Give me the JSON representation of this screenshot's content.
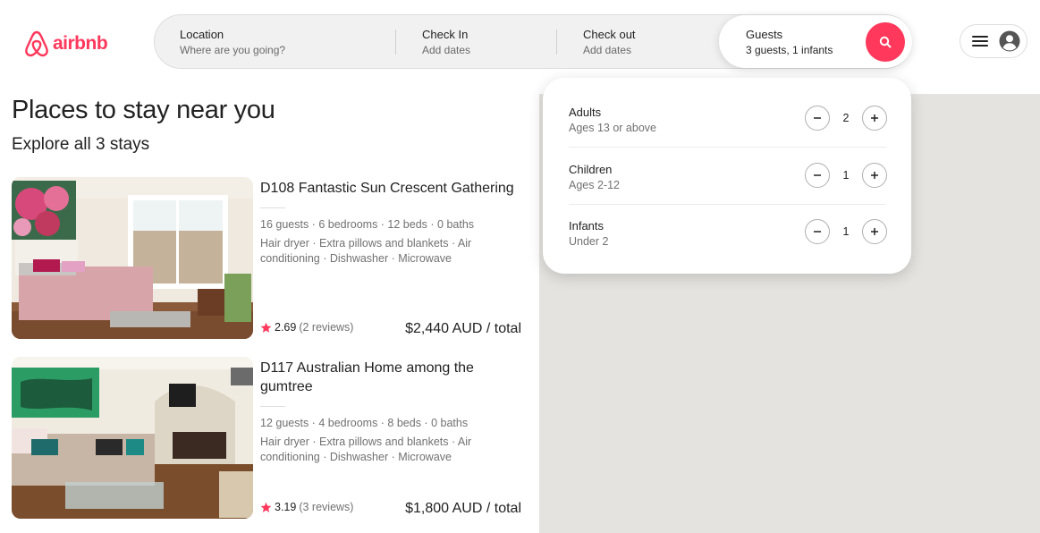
{
  "brand": {
    "name": "airbnb",
    "color": "#FF385C"
  },
  "search": {
    "location": {
      "label": "Location",
      "value": "Where are you going?"
    },
    "check_in": {
      "label": "Check In",
      "value": "Add dates"
    },
    "check_out": {
      "label": "Check out",
      "value": "Add dates"
    },
    "guests": {
      "label": "Guests",
      "value": "3 guests, 1 infants"
    },
    "button_icon": "search-icon"
  },
  "user_menu": {
    "icons": [
      "menu-icon",
      "user-avatar-icon"
    ]
  },
  "main": {
    "title": "Places to stay near you",
    "subtitle": "Explore all 3 stays"
  },
  "listings": [
    {
      "title": "D108 Fantastic Sun Crescent Gathering",
      "specs": "16 guests · 6 bedrooms · 12 beds · 0 baths",
      "amenities": "Hair dryer · Extra pillows and blankets · Air conditioning · Dishwasher · Microwave",
      "rating": "2.69",
      "reviews": "(2 reviews)",
      "price": "$2,440 AUD",
      "price_suffix": "/ total"
    },
    {
      "title": "D117 Australian Home among the gumtree",
      "specs": "12 guests · 4 bedrooms · 8 beds · 0 baths",
      "amenities": "Hair dryer · Extra pillows and blankets · Air conditioning · Dishwasher · Microwave",
      "rating": "3.19",
      "reviews": "(3 reviews)",
      "price": "$1,800 AUD",
      "price_suffix": "/ total"
    }
  ],
  "guest_picker": {
    "rows": [
      {
        "label": "Adults",
        "sub": "Ages 13 or above",
        "count": "2"
      },
      {
        "label": "Children",
        "sub": "Ages 2-12",
        "count": "1"
      },
      {
        "label": "Infants",
        "sub": "Under 2",
        "count": "1"
      }
    ]
  },
  "colors": {
    "accent": "#FF385C",
    "map_bg": "#e5e3df",
    "muted_text": "#717171"
  }
}
